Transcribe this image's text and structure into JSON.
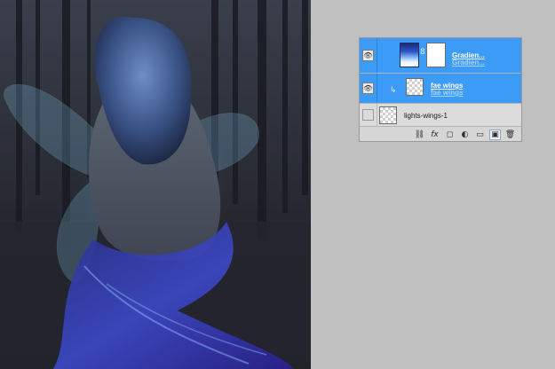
{
  "layers": [
    {
      "name": "Gradien...",
      "visible": true,
      "selected": true,
      "kind": "gradient-fill-with-mask"
    },
    {
      "name": "fae wings",
      "visible": true,
      "selected": true,
      "kind": "clipped-pixel-layer"
    },
    {
      "name": "lights-wings-1",
      "visible": false,
      "selected": false,
      "kind": "pixel-layer"
    }
  ],
  "footer_icons": [
    "link-layers-icon",
    "fx-icon",
    "add-mask-icon",
    "adjustment-layer-icon",
    "new-group-icon",
    "new-layer-icon",
    "trash-icon"
  ],
  "glyphs": {
    "link": "⛓",
    "fx": "fx",
    "mask": "◻",
    "adjust": "◐",
    "group": "▭",
    "new_layer": "▣",
    "trash": "🗑",
    "eye": "👁",
    "chain": "8",
    "clip": "↳"
  },
  "colors": {
    "selection": "#3d9bf8",
    "panel_bg": "#d6d6d6",
    "desktop_bg": "#c0c0c0"
  }
}
